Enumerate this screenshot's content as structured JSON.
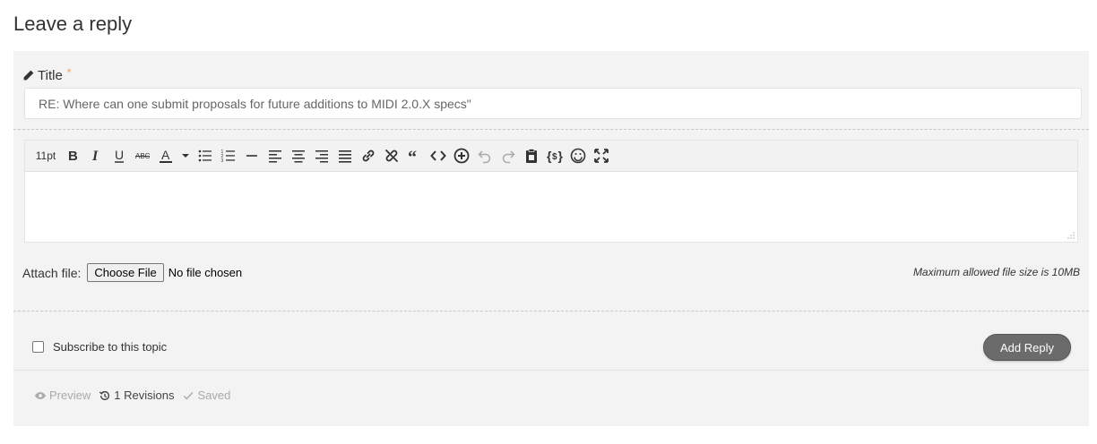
{
  "page": {
    "heading": "Leave a reply"
  },
  "form": {
    "title_label": "Title",
    "required_mark": "*",
    "title_value": "RE: Where can one submit proposals for future additions to MIDI 2.0.X specs\"",
    "editor": {
      "font_size": "11pt",
      "tools": [
        "bold-icon",
        "italic-icon",
        "underline-icon",
        "strikethrough-icon",
        "text-color-icon",
        "color-dropdown-icon",
        "bullet-list-icon",
        "numbered-list-icon",
        "horizontal-rule-icon",
        "align-left-icon",
        "align-center-icon",
        "align-right-icon",
        "justify-icon",
        "link-icon",
        "unlink-icon",
        "blockquote-icon",
        "code-icon",
        "insert-icon",
        "undo-icon",
        "redo-icon",
        "paste-icon",
        "code-block-icon",
        "emoji-icon",
        "fullscreen-icon"
      ]
    },
    "attach": {
      "label": "Attach file:",
      "button_label": "Choose File",
      "status": "No file chosen",
      "max_size": "Maximum allowed file size is 10MB"
    },
    "subscribe_label": "Subscribe to this topic",
    "subscribe_checked": false,
    "submit_label": "Add Reply"
  },
  "footer": {
    "preview": "Preview",
    "revisions": "1 Revisions",
    "saved": "Saved"
  },
  "colors": {
    "required": "#f0a045",
    "submit_bg": "#6b6b6b",
    "panel_bg": "#f3f3f3"
  }
}
